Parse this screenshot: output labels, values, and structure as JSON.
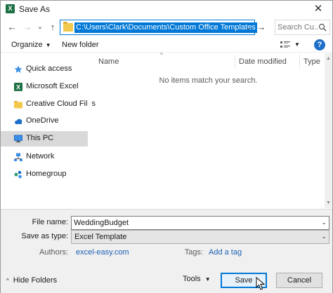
{
  "window": {
    "title": "Save As",
    "app_icon": "excel-app-icon",
    "close_glyph": "✕"
  },
  "nav": {
    "back_glyph": "←",
    "forward_glyph": "→",
    "up_glyph": "↑",
    "recent_glyph": "⌄",
    "address": "C:\\Users\\Clark\\Documents\\Custom Office Templates",
    "address_dropdown_glyph": "⌄",
    "go_glyph": "→",
    "search_placeholder": "Search Cu..."
  },
  "toolbar": {
    "organize_label": "Organize",
    "new_folder_label": "New folder",
    "caret": "▼",
    "help_glyph": "?"
  },
  "sidebar": {
    "items": [
      {
        "label": "Quick access",
        "icon": "star-icon",
        "color": "#3b8ee8",
        "selected": false
      },
      {
        "label": "Microsoft Excel",
        "icon": "excel-icon",
        "color": "#1e7145",
        "selected": false
      },
      {
        "label": "Creative Cloud Files",
        "icon": "folder-icon",
        "color": "#f2c94c",
        "selected": false
      },
      {
        "label": "OneDrive",
        "icon": "cloud-icon",
        "color": "#1d6fc9",
        "selected": false
      },
      {
        "label": "This PC",
        "icon": "computer-icon",
        "color": "#3b8ee8",
        "selected": true
      },
      {
        "label": "Network",
        "icon": "network-icon",
        "color": "#3b8ee8",
        "selected": false
      },
      {
        "label": "Homegroup",
        "icon": "homegroup-icon",
        "color": "#2e9e6b",
        "selected": false
      }
    ]
  },
  "filelist": {
    "columns": [
      "Name",
      "Date modified",
      "Type"
    ],
    "sort_caret": "^",
    "empty_message": "No items match your search."
  },
  "form": {
    "file_name_label": "File name:",
    "file_name_value": "WeddingBudget",
    "save_as_type_label": "Save as type:",
    "save_as_type_value": "Excel Template",
    "authors_label": "Authors:",
    "authors_value": "excel-easy.com",
    "tags_label": "Tags:",
    "tags_value": "Add a tag",
    "dropdown_caret": "⌄"
  },
  "footer": {
    "hide_folders_label": "Hide Folders",
    "hide_caret": "^",
    "tools_label": "Tools",
    "tools_caret": "▼",
    "save_label": "Save",
    "cancel_label": "Cancel"
  },
  "colors": {
    "accent": "#0078d7",
    "link": "#1a5fb4",
    "selected_row": "#d9d9d9"
  }
}
